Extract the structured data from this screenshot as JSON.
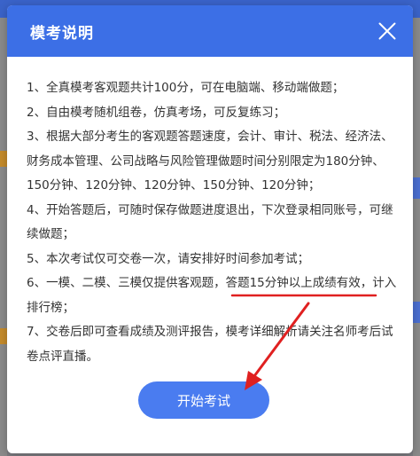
{
  "modal": {
    "title": "模考说明",
    "rules": [
      "1、全真模考客观题共计100分，可在电脑端、移动端做题；",
      "2、自由模考随机组卷，仿真考场，可反复练习；",
      "3、根据大部分考生的客观题答题速度，会计、审计、税法、经济法、财务成本管理、公司战略与风险管理做题时间分别限定为180分钟、150分钟、120分钟、120分钟、150分钟、120分钟；",
      "4、开始答题后，可随时保存做题进度退出，下次登录相同账号，可继续做题；",
      "5、本次考试仅可交卷一次，请安排好时间参加考试；",
      "7、交卷后即可查看成绩及测评报告，模考详细解析请关注名师考后试卷点评直播。"
    ],
    "rule6": {
      "before": "6、一模、二模、三模仅提供客观题，",
      "highlight": "答题15分钟以上成绩有效",
      "after": "，计入排行榜；"
    },
    "start_label": "开始考试"
  },
  "colors": {
    "header": "#3c6fe6",
    "button": "#4a7cf0",
    "annotation": "#e02020"
  },
  "icons": {
    "close": "close-icon"
  }
}
